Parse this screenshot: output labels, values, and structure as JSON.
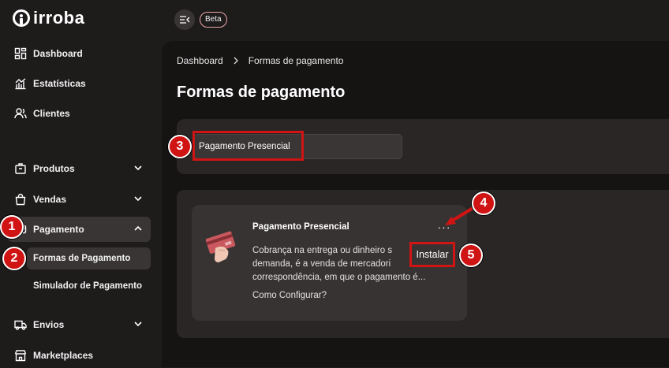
{
  "app": {
    "logo_text": "irroba",
    "beta_label": "Beta"
  },
  "sidebar": {
    "items": [
      {
        "label": "Dashboard",
        "icon": "dashboard-icon"
      },
      {
        "label": "Estatísticas",
        "icon": "chart-icon"
      },
      {
        "label": "Clientes",
        "icon": "users-icon"
      },
      {
        "label": "Produtos",
        "icon": "box-icon"
      },
      {
        "label": "Vendas",
        "icon": "bag-icon"
      },
      {
        "label": "Pagamento",
        "icon": "payment-icon"
      },
      {
        "label": "Envios",
        "icon": "truck-icon"
      },
      {
        "label": "Marketplaces",
        "icon": "store-icon"
      }
    ],
    "sub_items": [
      {
        "label": "Formas de Pagamento"
      },
      {
        "label": "Simulador de Pagamento"
      }
    ]
  },
  "breadcrumb": {
    "items": [
      "Dashboard",
      "Formas de pagamento"
    ]
  },
  "page": {
    "title": "Formas de pagamento"
  },
  "search": {
    "value": "Pagamento Presencial"
  },
  "card": {
    "title": "Pagamento Presencial",
    "description": "Cobrança na entrega ou dinheiro s... demanda, é a venda de mercadori... correspondência, em que o pagamento é...",
    "line1": "Cobrança na entrega ou dinheiro s",
    "line2": "demanda, é a venda de mercadori",
    "line3": "correspondência, em que o pagamento é...",
    "link": "Como Configurar?",
    "more": "···",
    "install_label": "Instalar"
  },
  "annotations": [
    "1",
    "2",
    "3",
    "4",
    "5"
  ],
  "colors": {
    "accent": "#d01414",
    "background": "#1e1b1b",
    "panel": "#2a2626",
    "card": "#383333"
  }
}
